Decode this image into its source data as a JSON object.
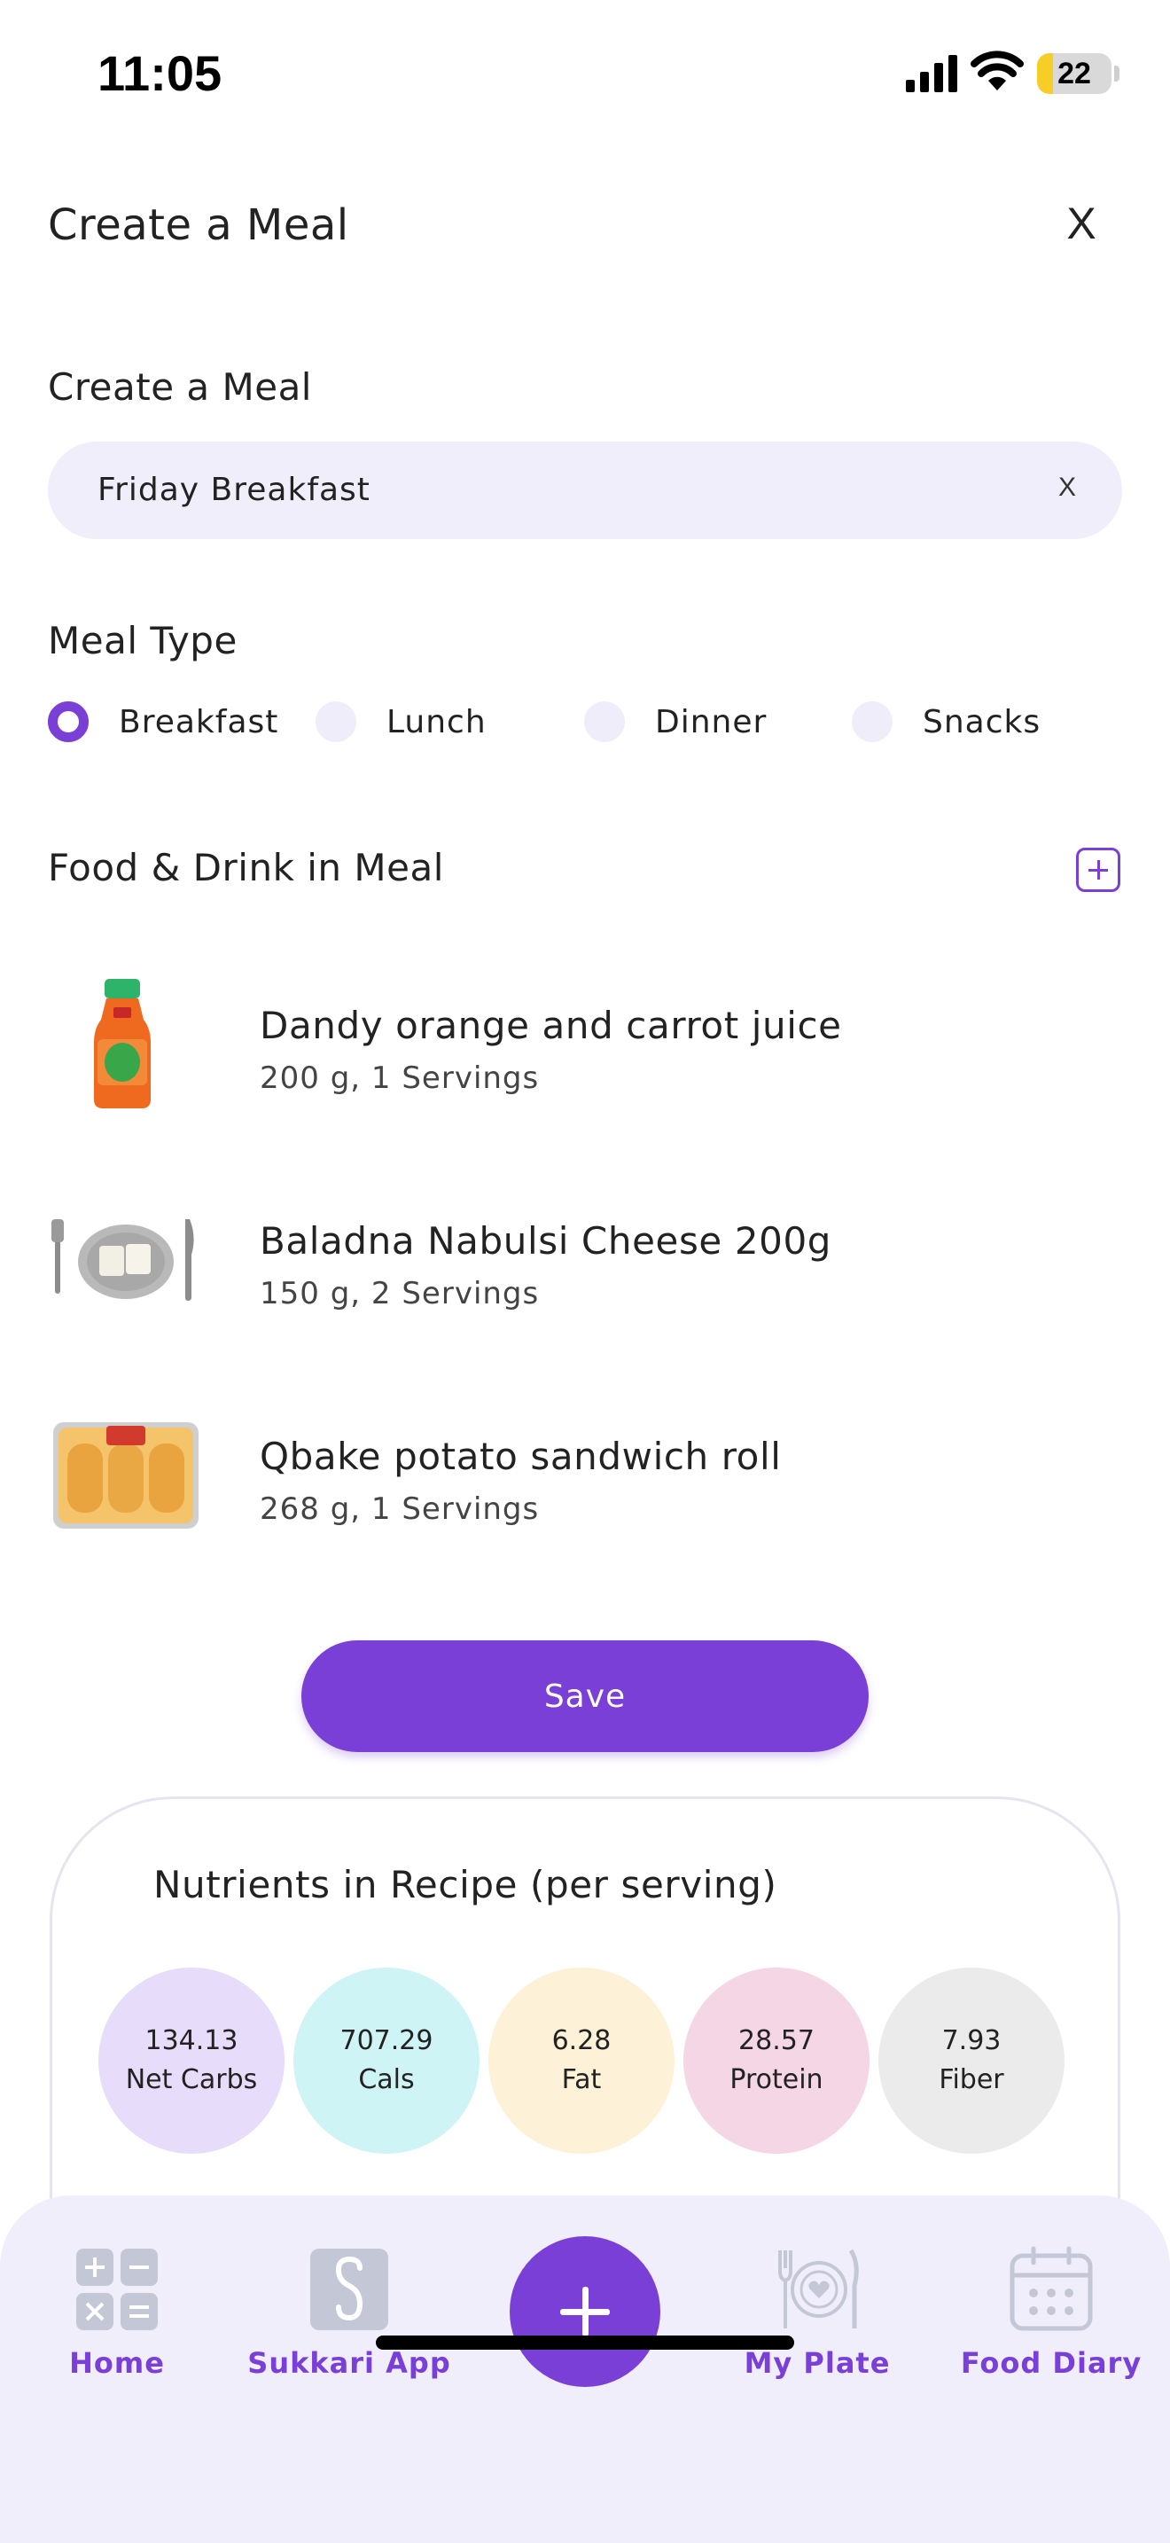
{
  "status_bar": {
    "time": "11:05",
    "battery_level": "22",
    "battery_fraction": 0.22,
    "icons": [
      "signal-icon",
      "wifi-icon",
      "battery-icon"
    ]
  },
  "header": {
    "title": "Create a Meal",
    "close_label": "X"
  },
  "meal_name": {
    "label": "Create a Meal",
    "value": "Friday Breakfast",
    "clear_label": "X"
  },
  "meal_type": {
    "label": "Meal Type",
    "selected": "Breakfast",
    "options": [
      {
        "label": "Breakfast"
      },
      {
        "label": "Lunch"
      },
      {
        "label": "Dinner"
      },
      {
        "label": "Snacks"
      }
    ]
  },
  "foods": {
    "label": "Food & Drink in Meal",
    "add_icon": "plus-square-icon",
    "items": [
      {
        "name": "Dandy orange and carrot juice",
        "detail": "200 g, 1 Servings",
        "thumb": "juice-bottle"
      },
      {
        "name": "Baladna Nabulsi Cheese 200g",
        "detail": "150 g, 2 Servings",
        "thumb": "cheese-plate"
      },
      {
        "name": "Qbake potato sandwich roll",
        "detail": "268 g, 1 Servings",
        "thumb": "bread-pack"
      }
    ]
  },
  "save_label": "Save",
  "nutrients": {
    "title": "Nutrients in Recipe (per serving)",
    "items": [
      {
        "value": "134.13",
        "label": "Net Carbs",
        "color": "#e7dcf9"
      },
      {
        "value": "707.29",
        "label": "Cals",
        "color": "#cff4f6"
      },
      {
        "value": "6.28",
        "label": "Fat",
        "color": "#fdf1d7"
      },
      {
        "value": "28.57",
        "label": "Protein",
        "color": "#f5d6e4"
      },
      {
        "value": "7.93",
        "label": "Fiber",
        "color": "#ebebeb"
      }
    ]
  },
  "nav": {
    "items": [
      {
        "label": "Home",
        "icon": "calculator-icon"
      },
      {
        "label": "Sukkari App",
        "icon": "sukkari-logo-icon"
      },
      {
        "label": "My Plate",
        "icon": "plate-icon"
      },
      {
        "label": "Food Diary",
        "icon": "calendar-icon"
      }
    ],
    "fab_icon": "plus-icon"
  },
  "colors": {
    "accent": "#7a3fd6",
    "field_bg": "#f0eefb",
    "nav_bg": "#f0eefb"
  }
}
